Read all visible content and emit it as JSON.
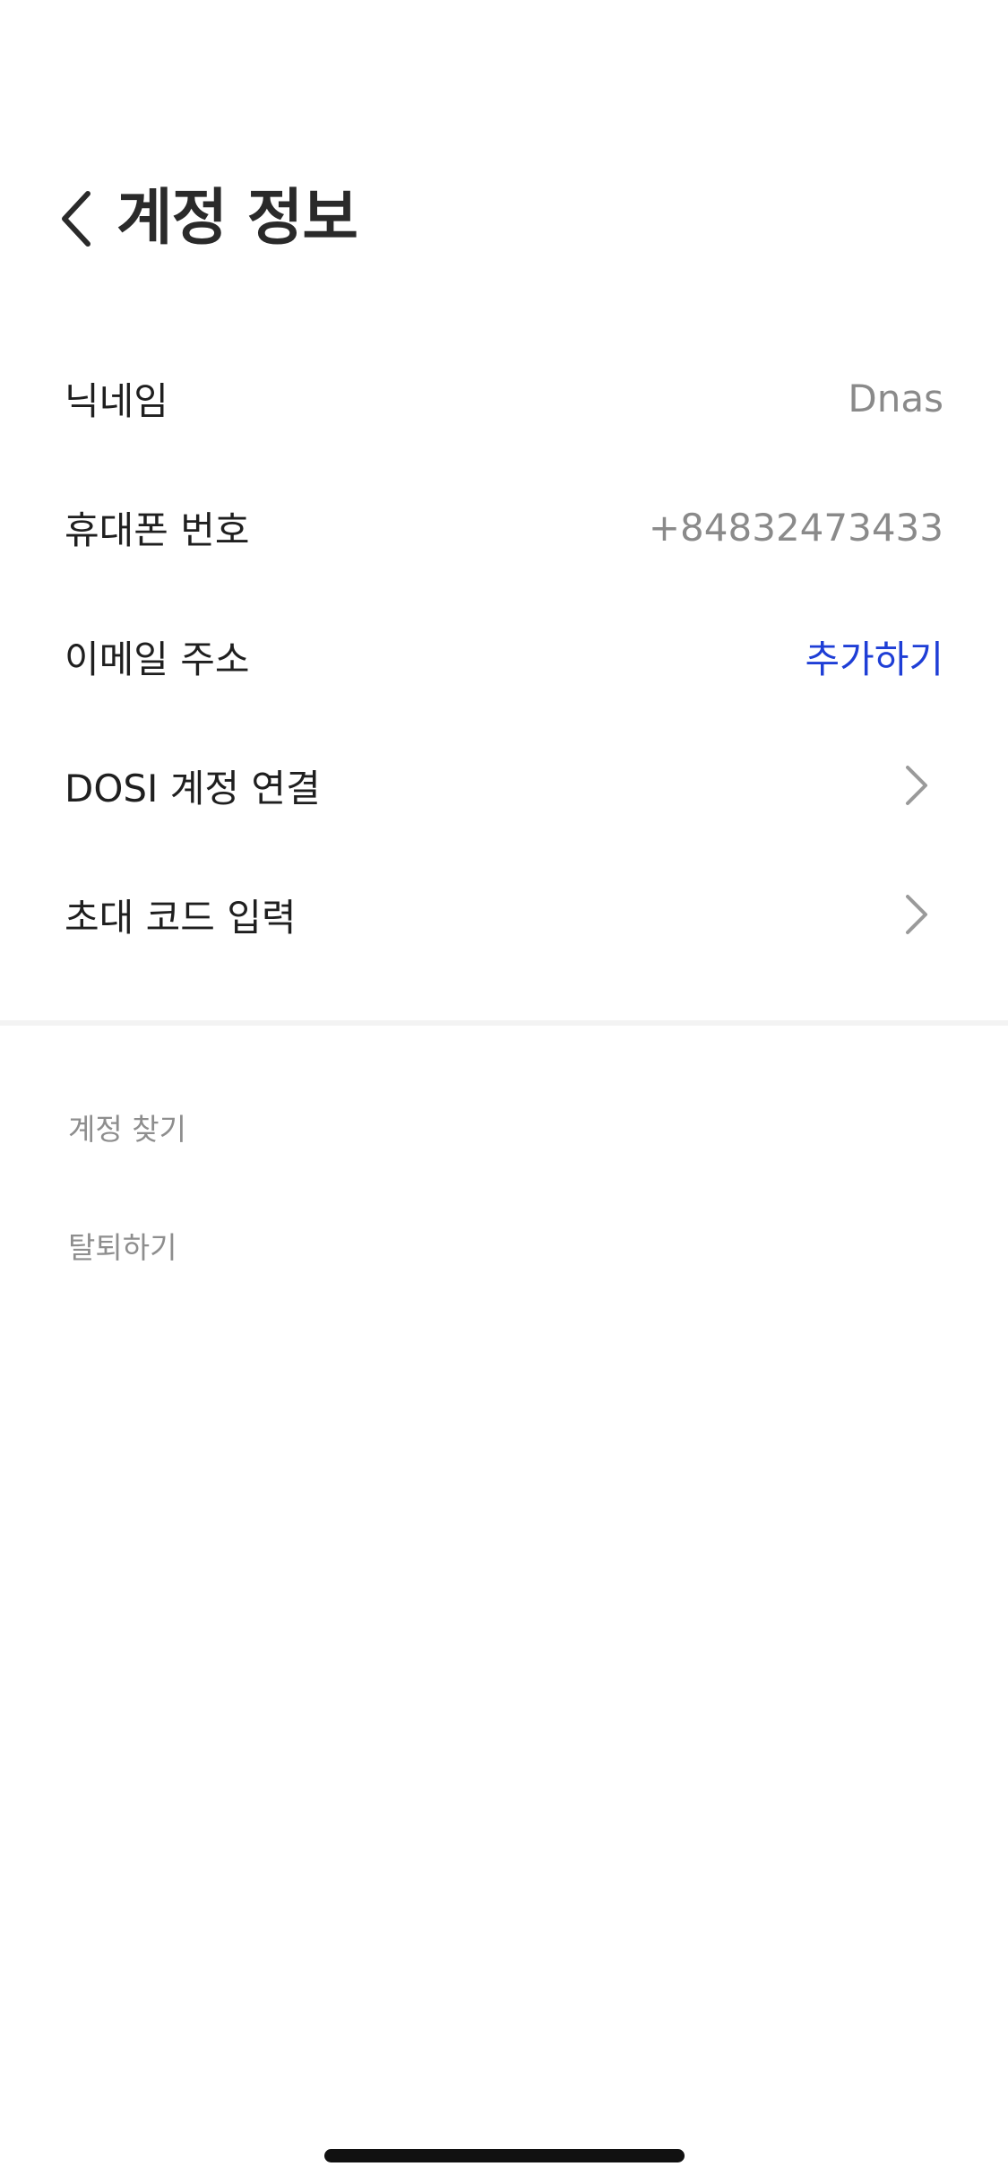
{
  "header": {
    "title": "계정 정보",
    "back_icon": "chevron-left-icon"
  },
  "rows": [
    {
      "label": "닉네임",
      "value": "Dnas"
    },
    {
      "label": "휴대폰 번호",
      "value": "+84832473433"
    },
    {
      "label": "이메일 주소",
      "action": "추가하기"
    },
    {
      "label": "DOSI 계정 연결",
      "icon": "chevron-right-icon"
    },
    {
      "label": "초대 코드 입력",
      "icon": "chevron-right-icon"
    }
  ],
  "footer": {
    "find_account": "계정 찾기",
    "withdraw": "탈퇴하기"
  },
  "colors": {
    "accent": "#1e3ed6",
    "value_text": "#8a8a8a",
    "secondary_text": "#8e8e8e",
    "divider": "#f3f3f3"
  }
}
